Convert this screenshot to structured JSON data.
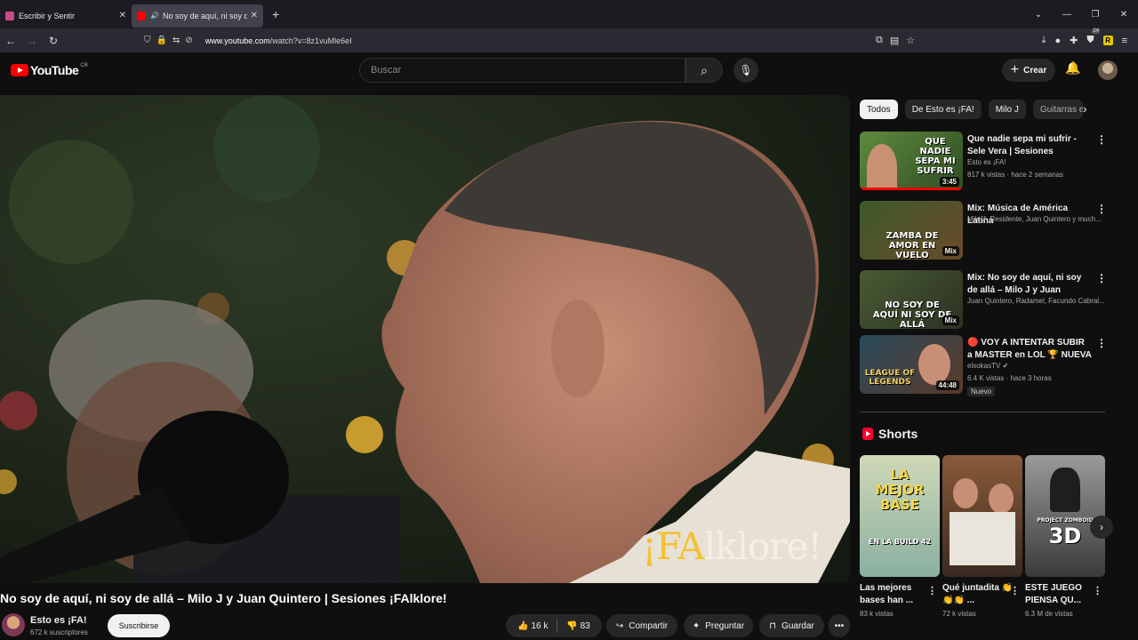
{
  "browser": {
    "tabs": [
      {
        "label": "Escribir y Sentir",
        "favicon_color": "#c94d8a"
      },
      {
        "label": "No soy de aquí, ni soy de allá",
        "favicon_color": "#ff0000"
      }
    ],
    "new_tab": "+",
    "url_host": "www.youtube.com",
    "url_path": "/watch?v=8z1vuMle6eI",
    "ext_badge": "24",
    "ext_r": "R"
  },
  "header": {
    "logo": "YouTube",
    "country": "CR",
    "search_placeholder": "Buscar",
    "create_label": "Crear"
  },
  "video": {
    "title": "No soy de aquí, ni soy de allá – Milo J y Juan Quintero | Sesiones ¡FAlklore!",
    "watermark_fa": "¡FA",
    "watermark_rest": "lklore!",
    "channel": "Esto es ¡FA!",
    "subscribers": "672 k suscriptores",
    "subscribe_label": "Suscribirse",
    "likes": "16 k",
    "dislikes": "83",
    "share_label": "Compartir",
    "ask_label": "Preguntar",
    "save_label": "Guardar"
  },
  "chips": [
    "Todos",
    "De Esto es ¡FA!",
    "Milo J",
    "Guitarras e"
  ],
  "recommendations": [
    {
      "title": "Que nadie sepa mi sufrir - Sele Vera | Sesiones ¡FAlklore!",
      "channel": "Esto es ¡FA!",
      "stats": "817 k vistas · hace 2 semanas",
      "duration": "3:45",
      "thumb_text": "QUE NADIE SEPA MI SUFRIR"
    },
    {
      "title": "Mix: Música de América Latina",
      "channel": "Milo J, Residente, Juan Quintero y much...",
      "stats": "",
      "duration": "Mix",
      "thumb_text": "ZAMBA DE AMOR EN VUELO"
    },
    {
      "title": "Mix: No soy de aquí, ni soy de allá – Milo J y Juan Quintero | ...",
      "channel": "Juan Quintero, Radamel, Facundo Cabral...",
      "stats": "",
      "duration": "Mix",
      "thumb_text": "NO SOY DE AQUÍ NI SOY DE ALLÁ"
    },
    {
      "title": "🔴 VOY A INTENTAR SUBIR a MASTER en LOL 🏆 NUEVA ...",
      "channel": "elxokasTV ✔",
      "stats": "6.4 K vistas · hace 3 horas",
      "duration": "44:48",
      "badge": "Nuevo",
      "thumb_text": "LEAGUE OF LEGENDS"
    }
  ],
  "shorts": {
    "heading": "Shorts",
    "items": [
      {
        "title": "Las mejores bases han ...",
        "views": "83 k vistas",
        "thumb_text": "LA MEJOR BASE",
        "thumb_sub": "EN LA BUILD 42"
      },
      {
        "title": "Qué juntadita 👏👏👏 ...",
        "views": "72 k vistas",
        "thumb_text": "",
        "thumb_sub": ""
      },
      {
        "title": "ESTE JUEGO PIENSA QU...",
        "views": "6.3 M de vistas",
        "thumb_text": "3D",
        "thumb_sub": "PROJECT ZOMBOID"
      }
    ]
  },
  "colors": {
    "accent": "#ff0000",
    "bg": "#0f0f0f",
    "chip": "#272727"
  }
}
